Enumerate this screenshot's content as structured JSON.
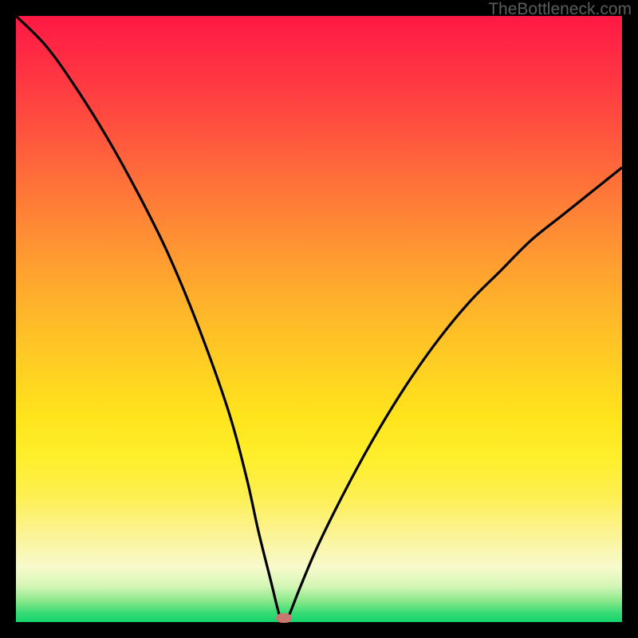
{
  "watermark": "TheBottleneck.com",
  "colors": {
    "curve_stroke": "#000000",
    "marker_fill": "#c67871",
    "frame_bg": "#000000"
  },
  "marker": {
    "x_frac": 0.442,
    "y_frac": 0.994
  },
  "chart_data": {
    "type": "line",
    "title": "",
    "xlabel": "",
    "ylabel": "",
    "xlim": [
      0,
      100
    ],
    "ylim": [
      0,
      100
    ],
    "series": [
      {
        "name": "bottleneck-curve",
        "x": [
          0,
          5,
          10,
          15,
          20,
          25,
          30,
          35,
          38,
          40,
          42,
          43.5,
          44.2,
          45,
          47,
          50,
          55,
          60,
          65,
          70,
          75,
          80,
          85,
          90,
          95,
          100
        ],
        "y": [
          100,
          95,
          88,
          80,
          71,
          61,
          49,
          35,
          24,
          15,
          7,
          1,
          0,
          1,
          6,
          13,
          23,
          32,
          40,
          47,
          53,
          58,
          63,
          67,
          71,
          75
        ]
      }
    ],
    "annotations": [
      {
        "type": "marker",
        "x": 44.2,
        "y": 0.6,
        "label": "optimal-point"
      }
    ]
  }
}
